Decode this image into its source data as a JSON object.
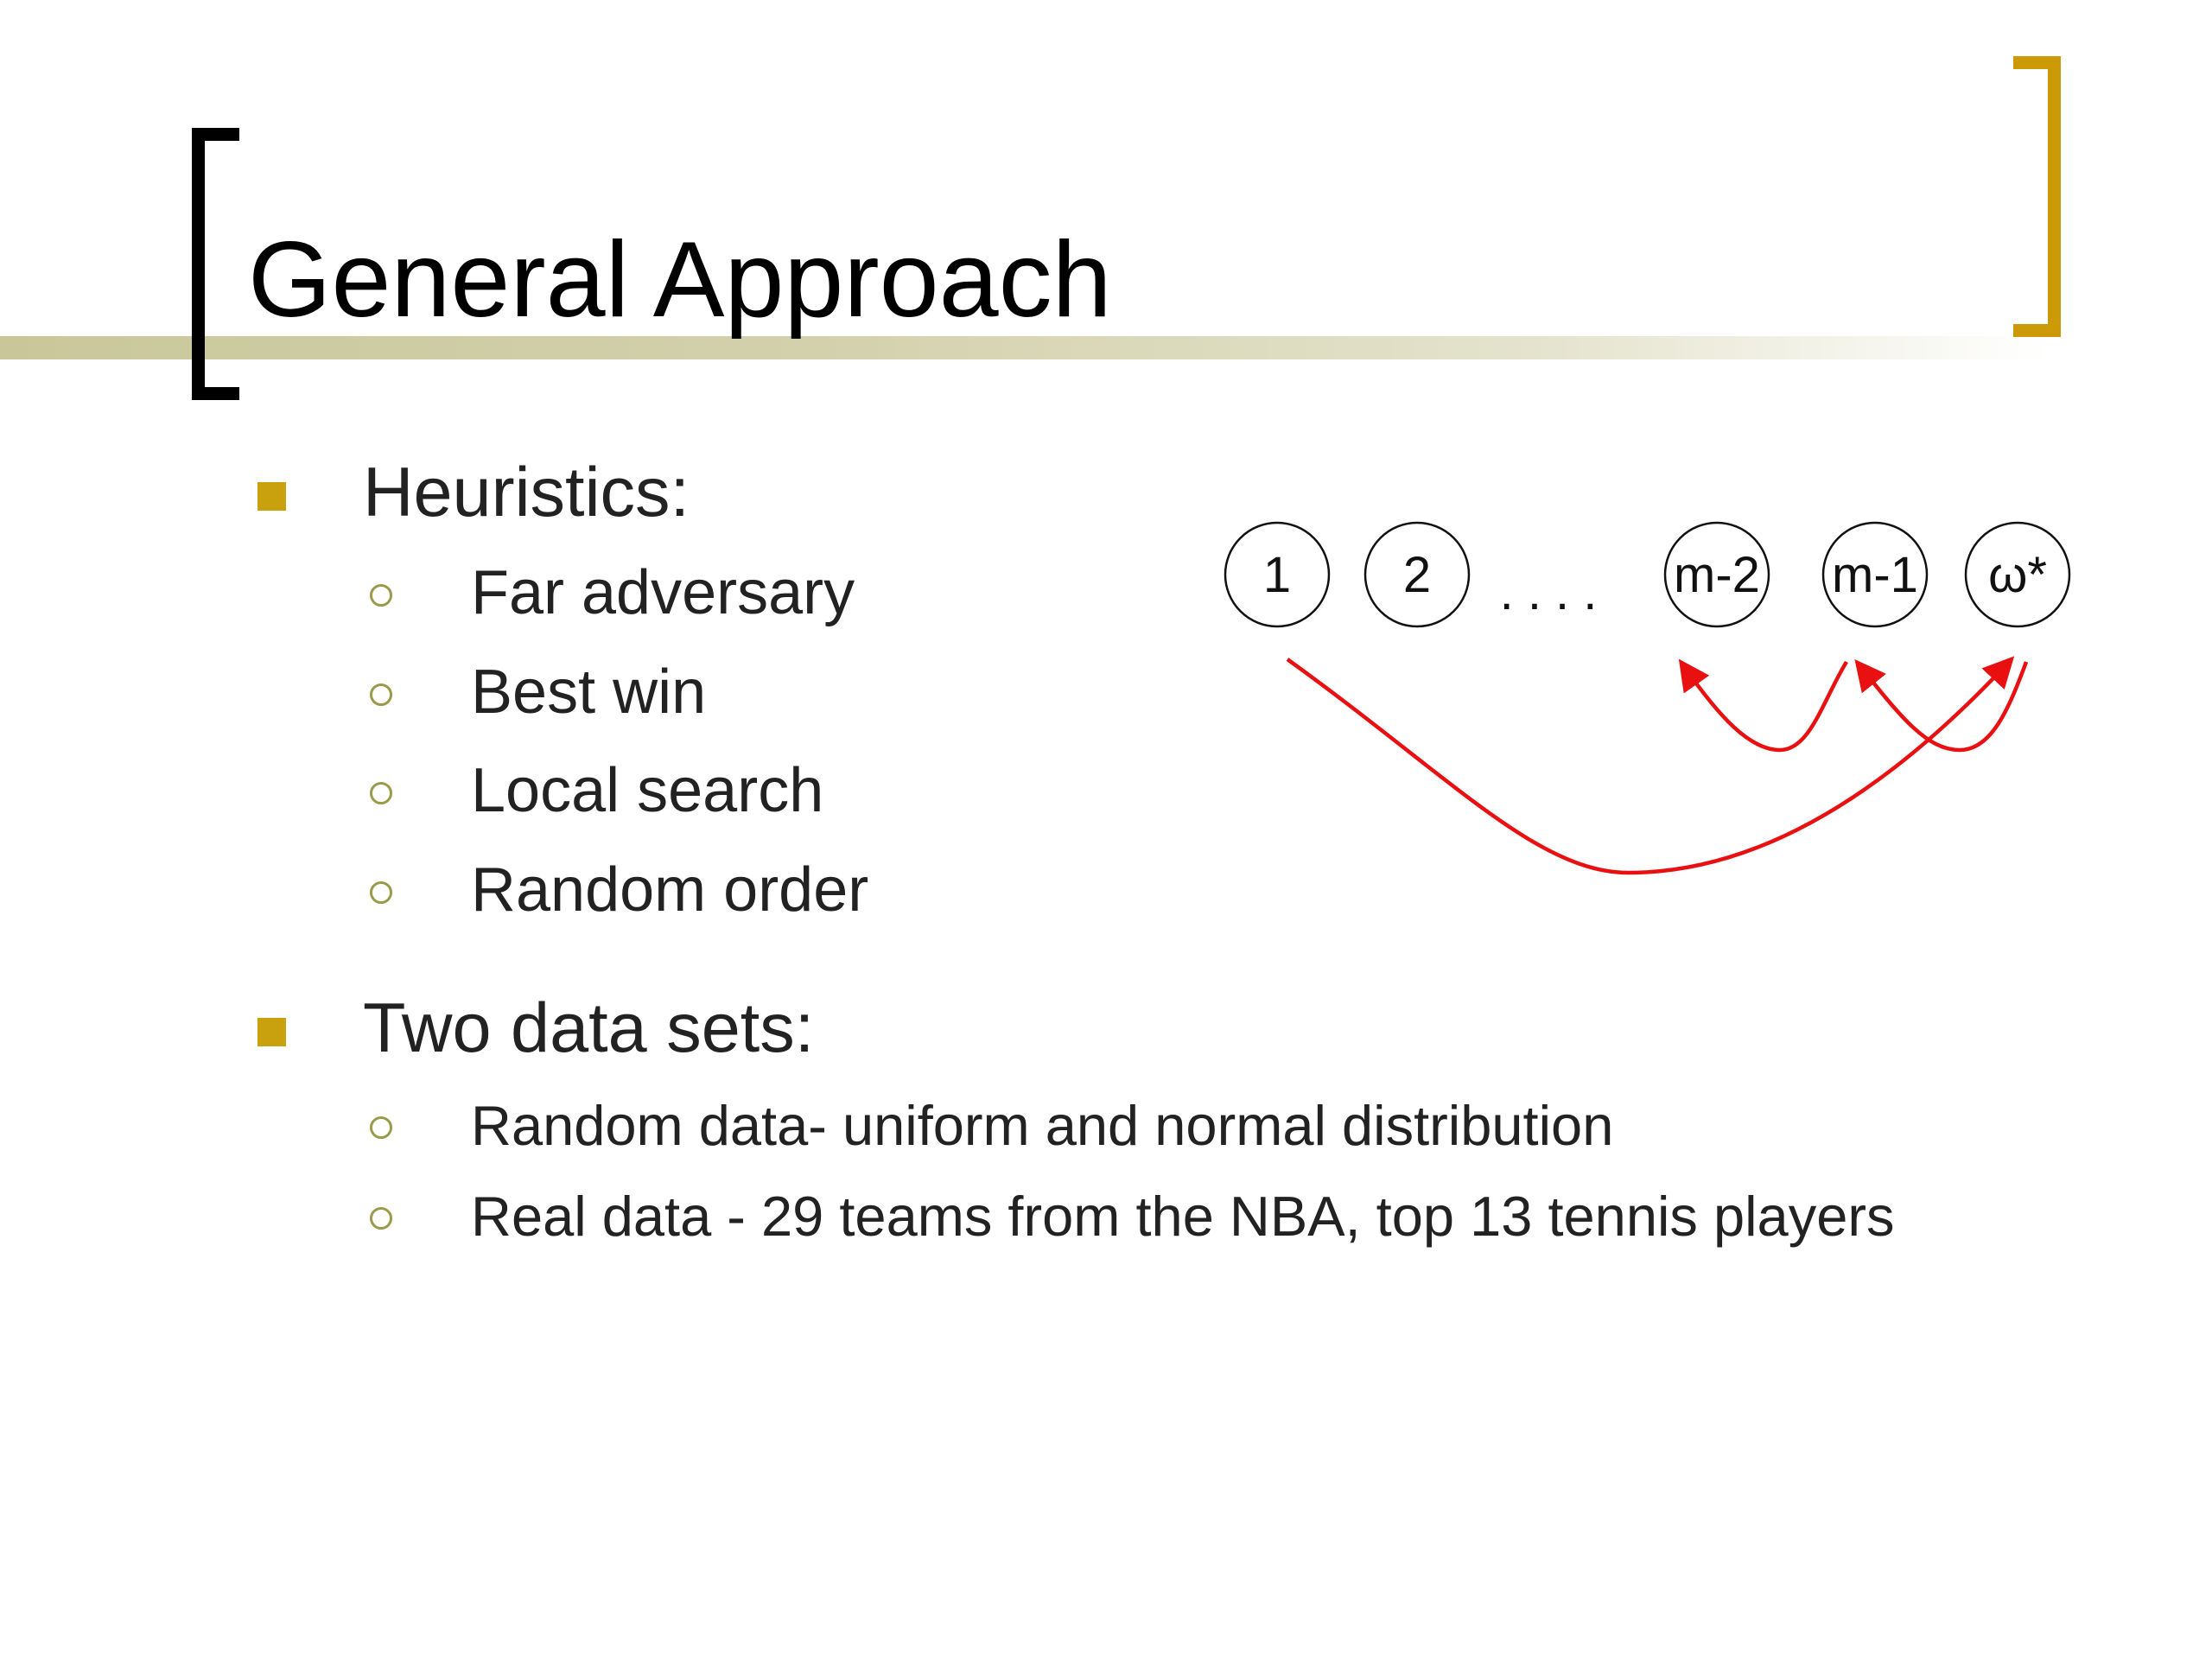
{
  "slide": {
    "title": "General Approach",
    "sections": [
      {
        "label": "Heuristics:",
        "items": [
          "Far adversary",
          "Best win",
          "Local search",
          "Random order"
        ]
      },
      {
        "label": "Two data sets:",
        "items": [
          "Random data- uniform and normal distribution",
          "Real data - 29 teams from the NBA, top 13 tennis players"
        ]
      }
    ]
  },
  "diagram": {
    "nodes": [
      "1",
      "2",
      "m-2",
      "m-1",
      "ω*"
    ],
    "ellipsis": ". . . .",
    "arrow_color": "#e81010"
  },
  "colors": {
    "title_bracket_left": "#000000",
    "title_bracket_right": "#cc9a06",
    "bullet": "#c9a10f",
    "sub_bullet": "#9a9a4a"
  }
}
